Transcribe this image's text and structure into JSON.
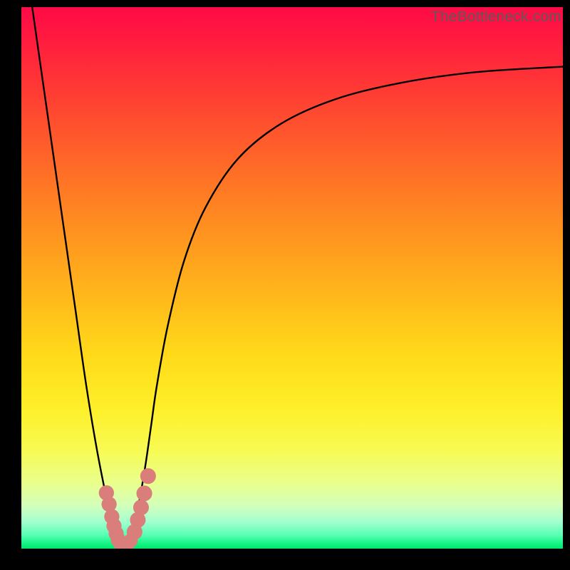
{
  "watermark": "TheBottleneck.com",
  "chart_data": {
    "type": "line",
    "title": "",
    "xlabel": "",
    "ylabel": "",
    "xlim": [
      0,
      100
    ],
    "ylim": [
      0,
      100
    ],
    "grid": false,
    "legend": false,
    "series": [
      {
        "name": "bottleneck-curve",
        "color": "#000000",
        "x": [
          2,
          4,
          6,
          8,
          10,
          12,
          14,
          16,
          17,
          18,
          18.6,
          19.2,
          20,
          21,
          22,
          23,
          24,
          25,
          27,
          30,
          34,
          40,
          48,
          58,
          70,
          84,
          100
        ],
        "y": [
          100,
          86,
          72,
          58,
          44,
          30,
          18,
          8,
          4,
          1.5,
          0.5,
          0.5,
          2,
          5,
          10,
          16,
          23,
          30,
          41,
          53,
          63,
          72,
          78.5,
          83,
          86,
          88,
          89
        ]
      }
    ],
    "markers": [
      {
        "name": "left-cluster",
        "color": "#d97e7a",
        "radius": 1.4,
        "points": [
          {
            "x": 15.7,
            "y": 10.3
          },
          {
            "x": 16.2,
            "y": 8.2
          },
          {
            "x": 16.7,
            "y": 5.9
          },
          {
            "x": 17.1,
            "y": 4.2
          },
          {
            "x": 17.5,
            "y": 2.8
          },
          {
            "x": 17.9,
            "y": 1.6
          }
        ]
      },
      {
        "name": "bottom-cluster",
        "color": "#d97e7a",
        "radius": 1.3,
        "points": [
          {
            "x": 18.4,
            "y": 0.7
          },
          {
            "x": 19.0,
            "y": 0.5
          },
          {
            "x": 19.6,
            "y": 0.8
          },
          {
            "x": 20.2,
            "y": 1.5
          }
        ]
      },
      {
        "name": "right-cluster",
        "color": "#d97e7a",
        "radius": 1.45,
        "points": [
          {
            "x": 20.9,
            "y": 3.1
          },
          {
            "x": 21.5,
            "y": 5.3
          },
          {
            "x": 22.1,
            "y": 7.6
          },
          {
            "x": 22.7,
            "y": 10.2
          },
          {
            "x": 23.4,
            "y": 13.4
          }
        ]
      }
    ]
  }
}
